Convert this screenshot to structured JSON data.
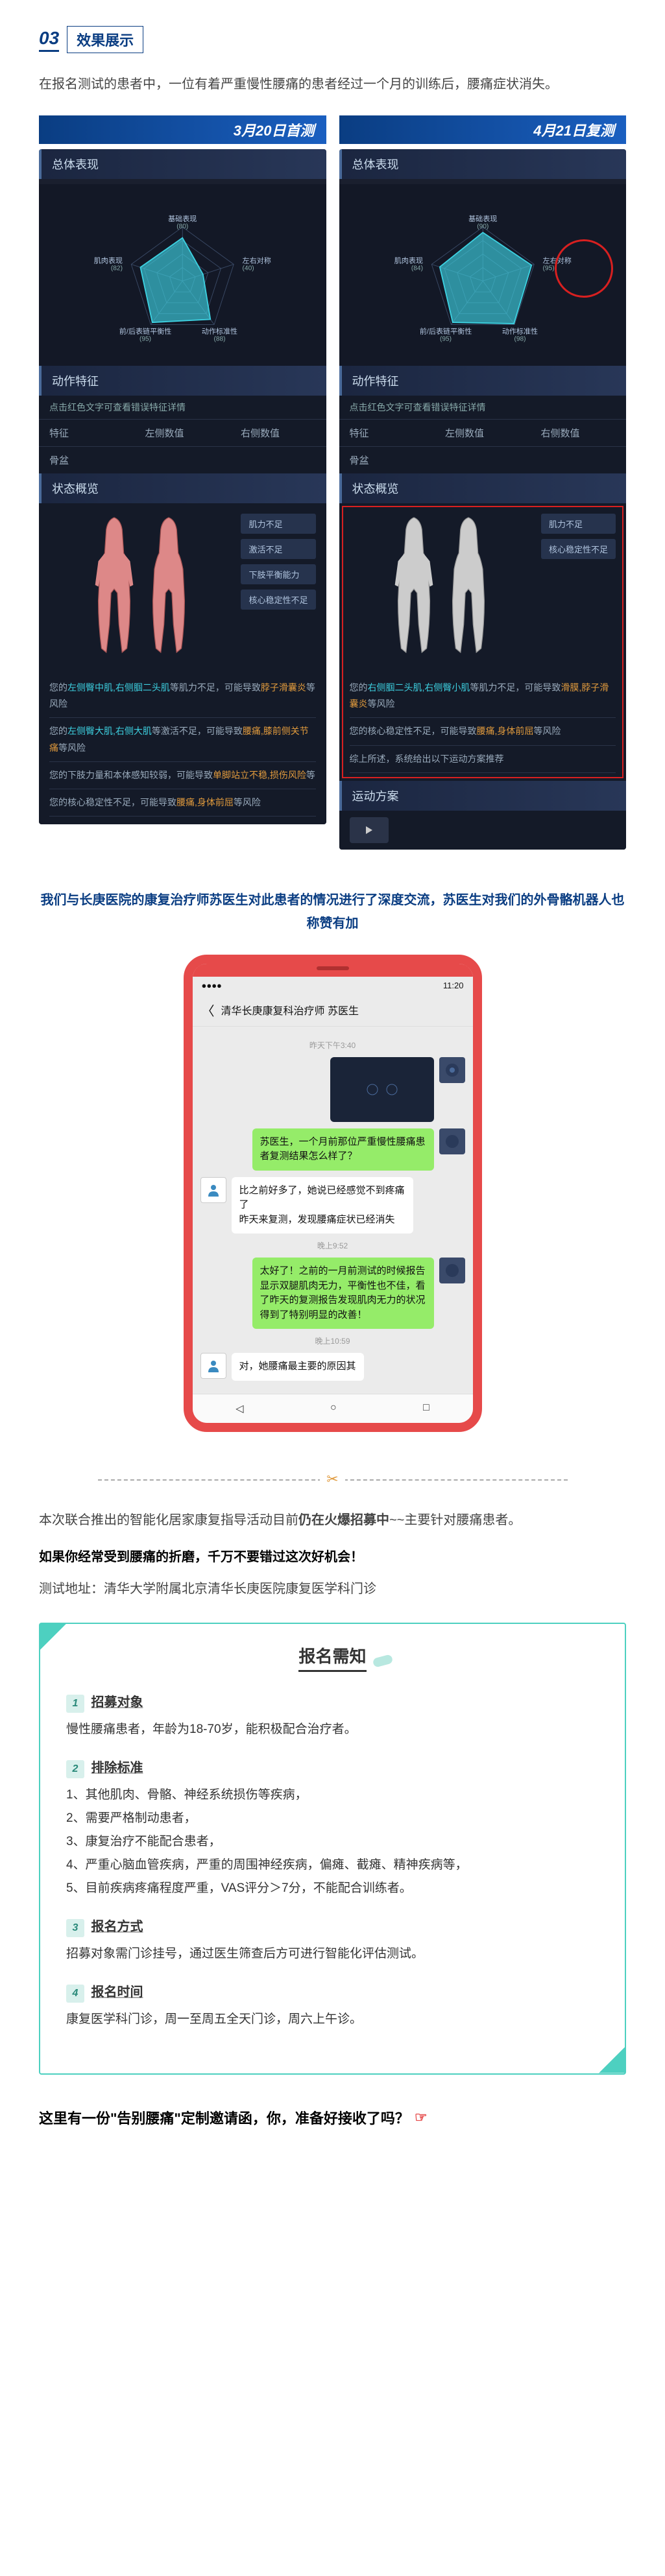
{
  "section": {
    "num": "03",
    "title": "效果展示"
  },
  "intro": "在报名测试的患者中，一位有着严重慢性腰痛的患者经过一个月的训练后，腰痛症状消失。",
  "compare": {
    "left": {
      "date": "3月20日首测",
      "tab_overall": "总体表现",
      "radar": {
        "labels": [
          "基础表现",
          "左右对称",
          "动作标准性",
          "前/后表链平衡性",
          "肌肉表现"
        ],
        "scores": [
          "(80)",
          "(40)",
          "(88)",
          "(95)",
          "(82)"
        ]
      },
      "tab_action": "动作特征",
      "action_note": "点击红色文字可查看错误特征详情",
      "cols": [
        "特征",
        "左侧数值",
        "右侧数值"
      ],
      "pelvis": "骨盆",
      "tab_status": "状态概览",
      "tags": [
        "肌力不足",
        "激活不足",
        "下肢平衡能力",
        "核心稳定性不足"
      ],
      "findings": [
        {
          "pre": "您的",
          "hl1": "左侧臀中肌,右侧腘二头肌",
          "mid": "等肌力不足，可能导致",
          "hl2": "脖子滑囊炎",
          "post": "等风险"
        },
        {
          "pre": "您的",
          "hl1": "左侧臀大肌,右侧大肌",
          "mid": "等激活不足，可能导致",
          "hl2": "腰痛,膝前侧关节痛",
          "post": "等风险"
        },
        {
          "pre": "您的下肢力量和本体感知较弱，可能导致",
          "hl2": "单脚站立不稳,损伤风险",
          "post": "等"
        },
        {
          "pre": "您的核心稳定性不足，可能导致",
          "hl2": "腰痛,身体前屈",
          "post": "等风险"
        }
      ]
    },
    "right": {
      "date": "4月21日复测",
      "tab_overall": "总体表现",
      "radar": {
        "labels": [
          "基础表现",
          "左右对称",
          "动作标准性",
          "前/后表链平衡性",
          "肌肉表现"
        ],
        "scores": [
          "(90)",
          "(95)",
          "(98)",
          "(95)",
          "(84)"
        ]
      },
      "tab_action": "动作特征",
      "action_note": "点击红色文字可查看错误特征详情",
      "cols": [
        "特征",
        "左侧数值",
        "右侧数值"
      ],
      "pelvis": "骨盆",
      "tab_status": "状态概览",
      "tags": [
        "肌力不足",
        "核心稳定性不足"
      ],
      "findings": [
        {
          "pre": "您的",
          "hl1": "右侧腘二头肌,右侧臀小肌",
          "mid": "等肌力不足，可能导致",
          "hl2": "滑膜,脖子滑囊炎",
          "post": "等风险"
        },
        {
          "pre": "您的核心稳定性不足，可能导致",
          "hl2": "腰痛,身体前屈",
          "post": "等风险"
        },
        {
          "pre": "综上所述，系统给出以下运动方案推荐"
        }
      ],
      "tab_plan": "运动方案"
    }
  },
  "doctor_praise": "我们与长庚医院的康复治疗师苏医生对此患者的情况进行了深度交流，苏医生对我们的外骨骼机器人也称赞有加",
  "chat": {
    "status_left": "●●●●",
    "status_right": "11:20",
    "title": "清华长庚康复科治疗师 苏医生",
    "msgs": [
      {
        "type": "time",
        "text": "昨天下午3:40"
      },
      {
        "type": "img-right"
      },
      {
        "type": "right",
        "text": "苏医生，一个月前那位严重慢性腰痛患者复测结果怎么样了？"
      },
      {
        "type": "left",
        "text": "比之前好多了，她说已经感觉不到疼痛了\n昨天来复测，发现腰痛症状已经消失"
      },
      {
        "type": "time",
        "text": "晚上9:52"
      },
      {
        "type": "right",
        "text": "太好了！之前的一月前测试的时候报告显示双腿肌肉无力，平衡性也不佳，看了昨天的复测报告发现肌肉无力的状况得到了特别明显的改善！"
      },
      {
        "type": "time",
        "text": "晚上10:59"
      },
      {
        "type": "left-partial",
        "text": "对，她腰痛最主要的原因其"
      }
    ],
    "nav": [
      "◁",
      "○",
      "□"
    ]
  },
  "recruit": {
    "line1_pre": "本次联合推出的智能化居家康复指导活动目前",
    "line1_bold": "仍在火爆招募中",
    "line1_post": "~~主要针对腰痛患者。",
    "line2": "如果你经常受到腰痛的折磨，千万不要错过这次好机会！",
    "loc": "测试地址：清华大学附属北京清华长庚医院康复医学科门诊"
  },
  "notice": {
    "title": "报名需知",
    "items": [
      {
        "num": "1",
        "label": "招募对象",
        "body": "慢性腰痛患者，年龄为18-70岁，能积极配合治疗者。"
      },
      {
        "num": "2",
        "label": "排除标准",
        "body": "1、其他肌肉、骨骼、神经系统损伤等疾病，\n2、需要严格制动患者，\n3、康复治疗不能配合患者，\n4、严重心脑血管疾病，严重的周围神经疾病，偏瘫、截瘫、精神疾病等，\n5、目前疾病疼痛程度严重，VAS评分＞7分，不能配合训练者。"
      },
      {
        "num": "3",
        "label": "报名方式",
        "body": "招募对象需门诊挂号，通过医生筛查后方可进行智能化评估测试。"
      },
      {
        "num": "4",
        "label": "报名时间",
        "body": "康复医学科门诊，周一至周五全天门诊，周六上午诊。"
      }
    ]
  },
  "closing": "这里有一份\"告别腰痛\"定制邀请函，你，准备好接收了吗？"
}
